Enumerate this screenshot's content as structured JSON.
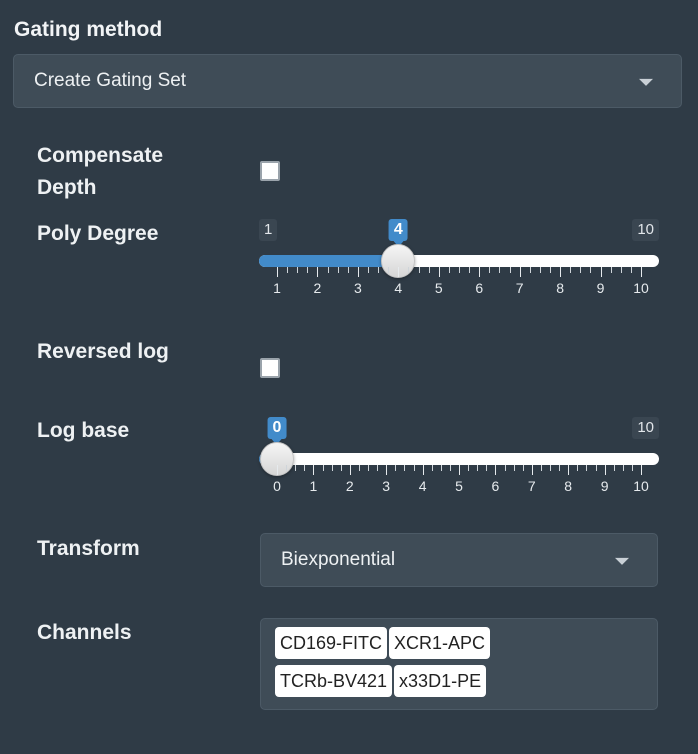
{
  "gating": {
    "title": "Gating method",
    "selected": "Create Gating Set"
  },
  "compensate_depth": {
    "label_line1": "Compensate",
    "label_line2": "Depth",
    "checked": false
  },
  "poly_degree": {
    "label": "Poly Degree",
    "min": 1,
    "max": 10,
    "value": 4,
    "min_label": "1",
    "max_label": "10",
    "value_label": "4",
    "tick_labels": [
      "1",
      "2",
      "3",
      "4",
      "5",
      "6",
      "7",
      "8",
      "9",
      "10"
    ]
  },
  "reversed_log": {
    "label": "Reversed log",
    "checked": false
  },
  "log_base": {
    "label": "Log base",
    "min": 0,
    "max": 10,
    "value": 0,
    "min_label": "0",
    "max_label": "10",
    "value_label": "0",
    "tick_labels": [
      "0",
      "1",
      "2",
      "3",
      "4",
      "5",
      "6",
      "7",
      "8",
      "9",
      "10"
    ]
  },
  "transform": {
    "label": "Transform",
    "selected": "Biexponential"
  },
  "channels": {
    "label": "Channels",
    "items": [
      "CD169-FITC",
      "XCR1-APC",
      "TCRb-BV421",
      "x33D1-PE"
    ]
  },
  "colors": {
    "background": "#2f3b46",
    "accent": "#428bca",
    "input_bg": "#3f4c57"
  }
}
